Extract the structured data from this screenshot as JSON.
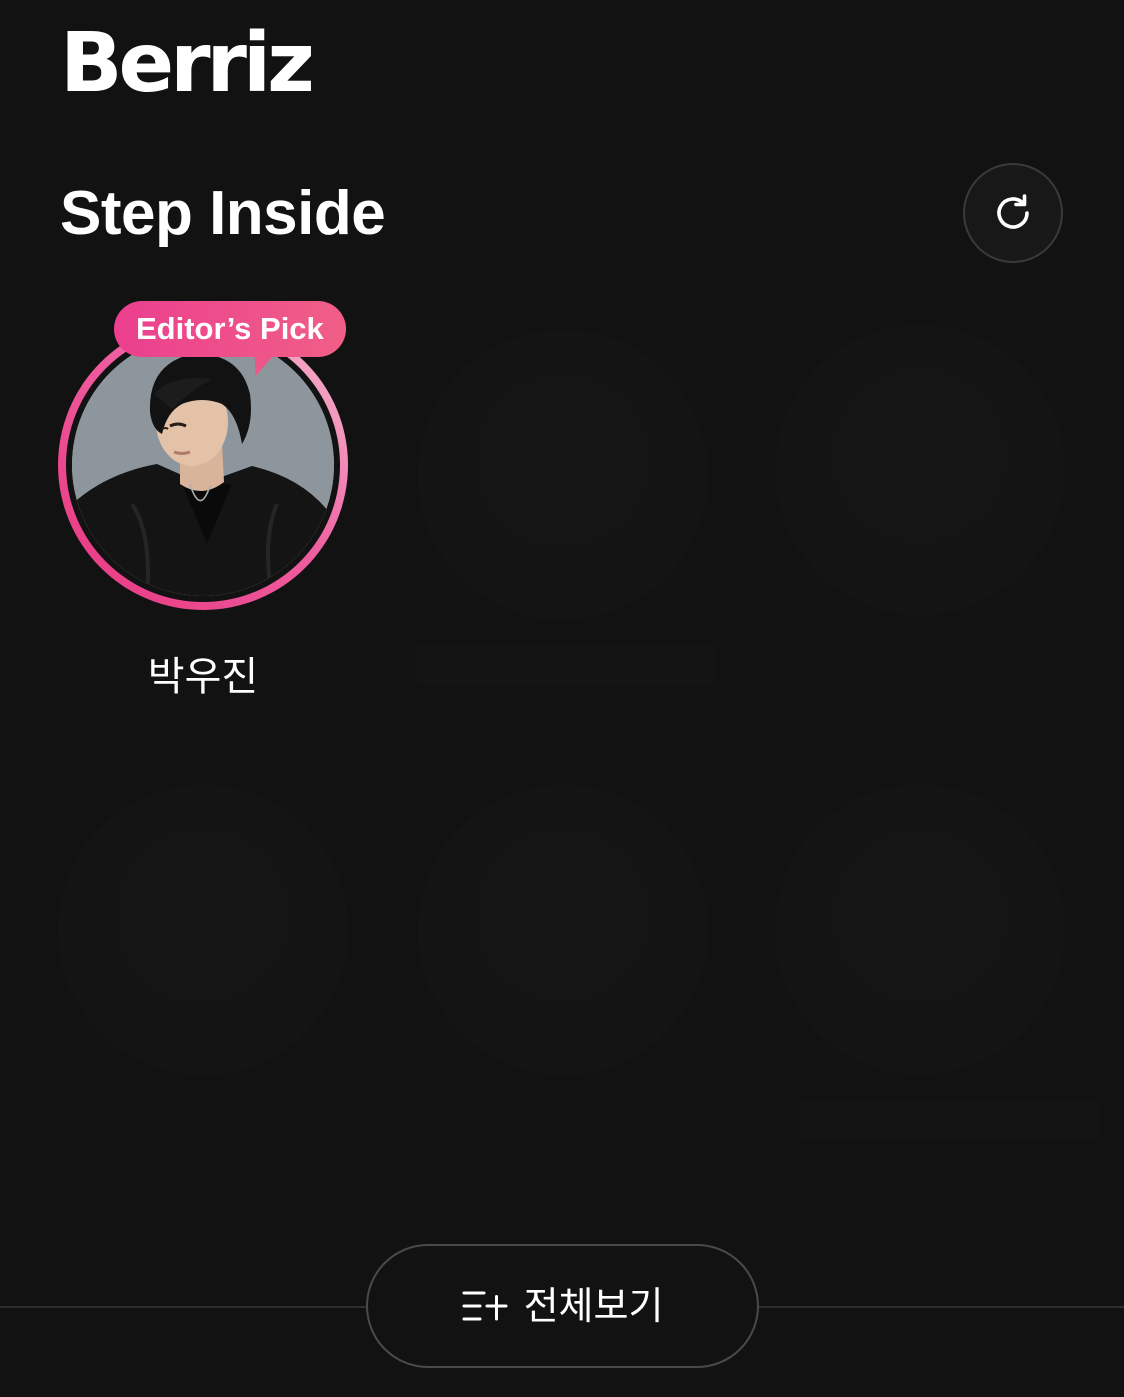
{
  "brand": {
    "logo_text": "Berriz"
  },
  "section": {
    "title": "Step Inside",
    "refresh_icon": "refresh-icon"
  },
  "featured_artist": {
    "name": "박우진",
    "badge": "Editor’s Pick",
    "accent_colors": [
      "#e8357f",
      "#f6c3d4"
    ]
  },
  "footer": {
    "view_all_label": "전체보기",
    "view_all_icon": "list-add-icon"
  },
  "colors": {
    "background": "#121212",
    "text": "#ffffff",
    "badge_gradient": [
      "#ec3f8f",
      "#f05f86"
    ]
  }
}
